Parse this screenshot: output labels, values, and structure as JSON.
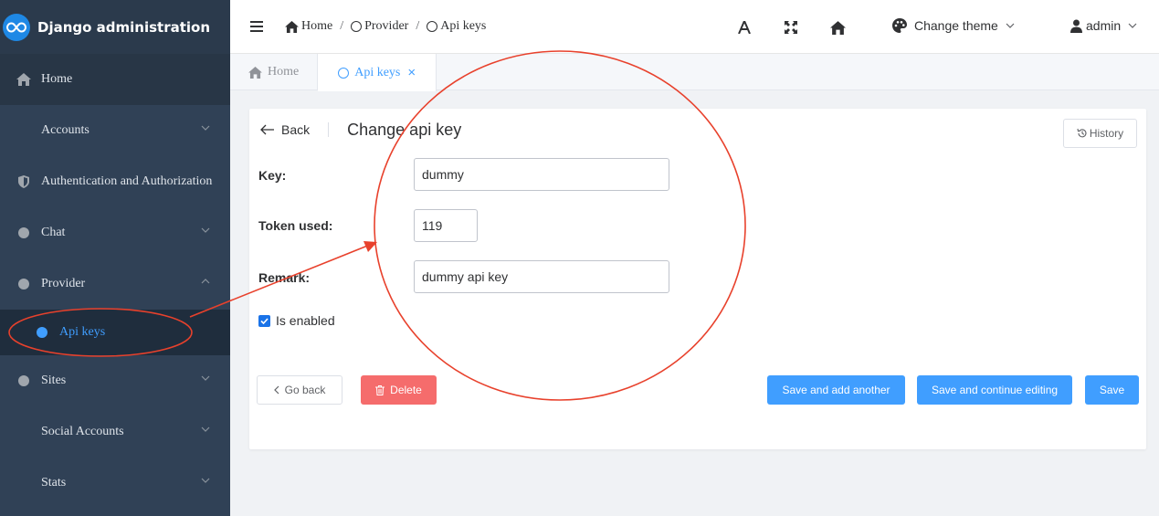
{
  "brand": {
    "title": "Django administration"
  },
  "sidebar": {
    "items": [
      {
        "label": "Home"
      },
      {
        "label": "Accounts"
      },
      {
        "label": "Authentication and Authorization"
      },
      {
        "label": "Chat"
      },
      {
        "label": "Provider"
      },
      {
        "label": "Api keys"
      },
      {
        "label": "Sites"
      },
      {
        "label": "Social Accounts"
      },
      {
        "label": "Stats"
      }
    ]
  },
  "header": {
    "breadcrumb": [
      "Home",
      "Provider",
      "Api keys"
    ],
    "breadcrumb_sep": "/",
    "theme_label": "Change theme",
    "user_label": "admin"
  },
  "tabs": [
    {
      "label": "Home"
    },
    {
      "label": "Api keys",
      "close": "×"
    }
  ],
  "form": {
    "back_label": "Back",
    "title": "Change api key",
    "history_label": "History",
    "fields": {
      "key": {
        "label": "Key:",
        "value": "dummy"
      },
      "token": {
        "label": "Token used:",
        "value": "119"
      },
      "remark": {
        "label": "Remark:",
        "value": "dummy api key"
      }
    },
    "is_enabled": {
      "label": "Is enabled",
      "checked": true
    },
    "buttons": {
      "go_back": "Go back",
      "delete": "Delete",
      "save_add": "Save and add another",
      "save_continue": "Save and continue editing",
      "save": "Save"
    }
  },
  "colors": {
    "sidebar_bg": "#304156",
    "accent": "#409eff",
    "danger": "#f56c6c",
    "annotation": "#e8412c"
  },
  "icons": {
    "font_size": "font-size-icon",
    "fullscreen": "fullscreen-icon",
    "home": "home-icon",
    "theme": "palette-icon",
    "user": "user-icon"
  }
}
